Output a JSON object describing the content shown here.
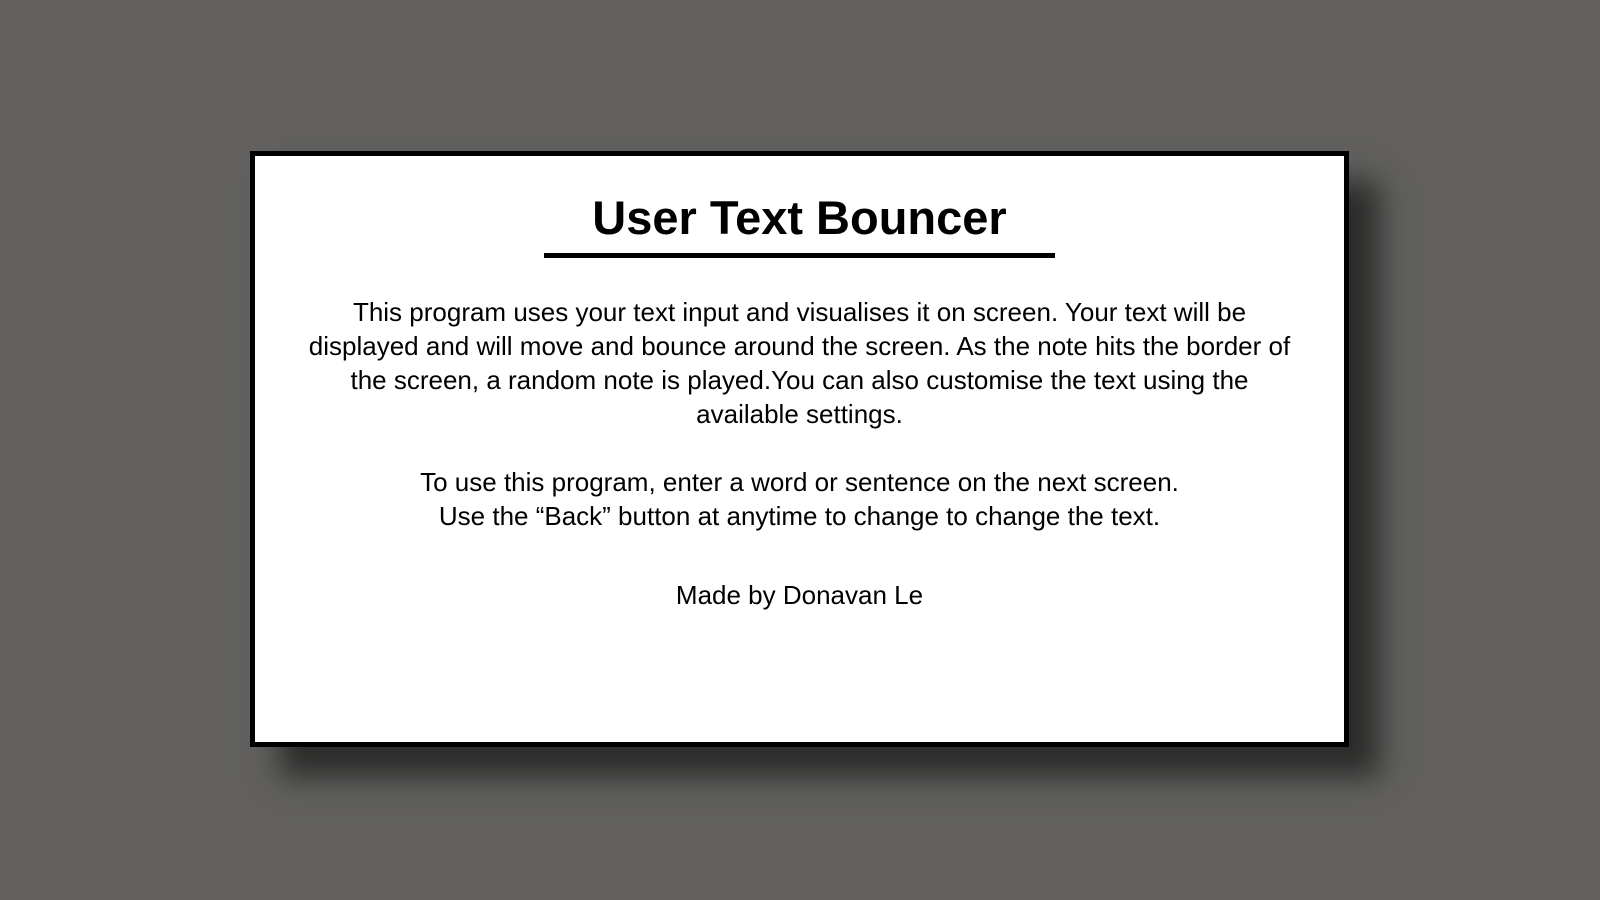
{
  "window": {
    "title": "User Text Bouncer",
    "description": "This program uses your text input and visualises it on screen. Your text will be displayed and will move and bounce around the screen. As the note hits the border of the screen, a random note is played.You can also customise the text using the available settings.",
    "instructions": [
      "To use this program, enter a word or sentence on the next screen.",
      "Use the “Back” button at anytime to change to change the text."
    ],
    "credit": "Made by Donavan Le"
  },
  "colors": {
    "background": "#61605e",
    "card": "#ffffff",
    "border": "#000000",
    "text": "#000000"
  }
}
